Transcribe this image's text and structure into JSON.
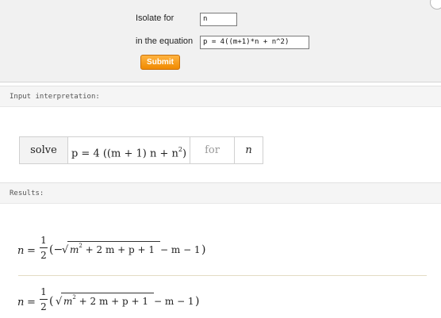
{
  "form": {
    "isolate_label": "Isolate for",
    "isolate_value": "n",
    "equation_label": "in the equation",
    "equation_value": "p = 4((m+1)*n + n^2)",
    "submit_label": "Submit"
  },
  "input_interpretation": {
    "header": "Input interpretation:",
    "solve": "solve",
    "equation_lhs": "p = 4 ((m + 1) n + n",
    "equation_exp": "2",
    "equation_close": ")",
    "for": "for",
    "variable": "n"
  },
  "results": {
    "header": "Results:",
    "items": [
      {
        "lhs": "n",
        "eq": "=",
        "frac_num": "1",
        "frac_den": "2",
        "lead": "(−",
        "rad_m": "m",
        "rad_exp": "2",
        "rad_rest": " + 2 m + p + 1",
        "tail": " − m − 1",
        "close": ")"
      },
      {
        "lhs": "n",
        "eq": "=",
        "frac_num": "1",
        "frac_den": "2",
        "lead": "(",
        "rad_m": "m",
        "rad_exp": "2",
        "rad_rest": " + 2 m + p + 1",
        "tail": " − m − 1",
        "close": ")"
      }
    ]
  }
}
